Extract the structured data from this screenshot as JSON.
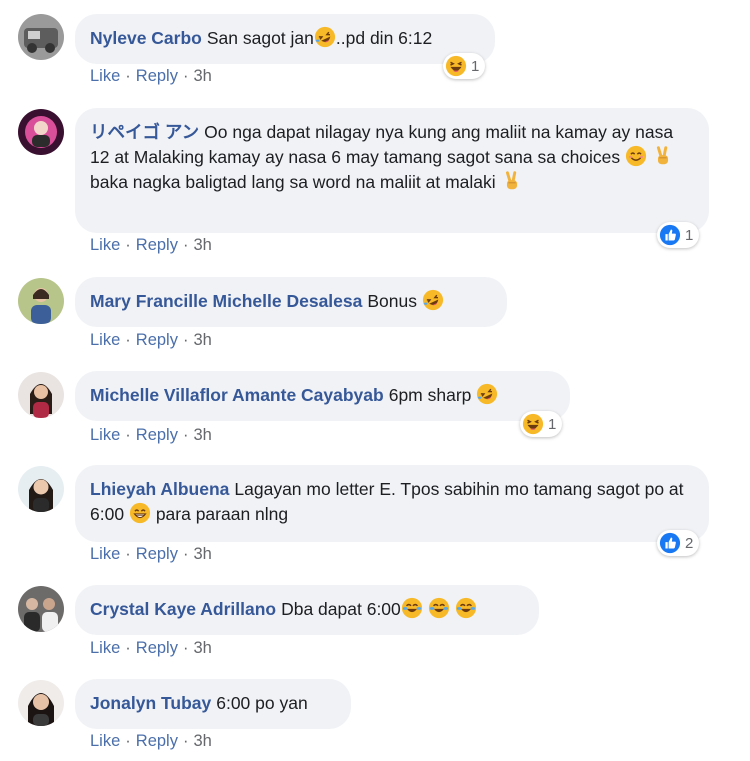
{
  "actions": {
    "like": "Like",
    "reply": "Reply",
    "separator": "·"
  },
  "colors": {
    "author": "#365899",
    "bubble": "#f0f2f5",
    "link": "#4b6faa",
    "like_blue": "#1877f2",
    "emoji_yellow": "#f7b928"
  },
  "comments": [
    {
      "author": "Nyleve Carbo",
      "text_before": "San sagot jan",
      "emoji": "rofl-emoji",
      "text_after": "..pd din 6:12",
      "time": "3h",
      "reaction": {
        "icon": "haha-reaction-icon",
        "count": "1"
      }
    },
    {
      "author": "リペイゴ アン",
      "text_before": "Oo nga dapat nilagay nya kung ang maliit na kamay ay nasa 12 at Malaking kamay ay nasa 6 may tamang sagot sana sa choices",
      "emoji": "smile-emoji",
      "text_mid": "baka nagka baligtad lang sa word na maliit at malaki",
      "emoji2": "victory-hand-emoji",
      "time": "3h",
      "reaction": {
        "icon": "like-reaction-icon",
        "count": "1"
      }
    },
    {
      "author": "Mary Francille Michelle Desalesa",
      "text_before": "Bonus",
      "emoji": "rofl-emoji",
      "time": "3h"
    },
    {
      "author": "Michelle Villaflor Amante Cayabyab",
      "text_before": "6pm sharp",
      "emoji": "rofl-emoji",
      "time": "3h",
      "reaction": {
        "icon": "haha-reaction-icon",
        "count": "1"
      }
    },
    {
      "author": "Lhieyah Albuena",
      "text_before": "Lagayan mo letter E. Tpos sabihin mo tamang sagot po at 6:00",
      "emoji": "grin-emoji",
      "text_after": "para paraan nlng",
      "time": "3h",
      "reaction": {
        "icon": "like-reaction-icon",
        "count": "2"
      }
    },
    {
      "author": "Crystal Kaye Adrillano",
      "text_before": "Dba dapat 6:00",
      "emoji": "joy-emoji",
      "time": "3h"
    },
    {
      "author": "Jonalyn Tubay",
      "text_before": "6:00 po yan",
      "time": "3h"
    }
  ]
}
